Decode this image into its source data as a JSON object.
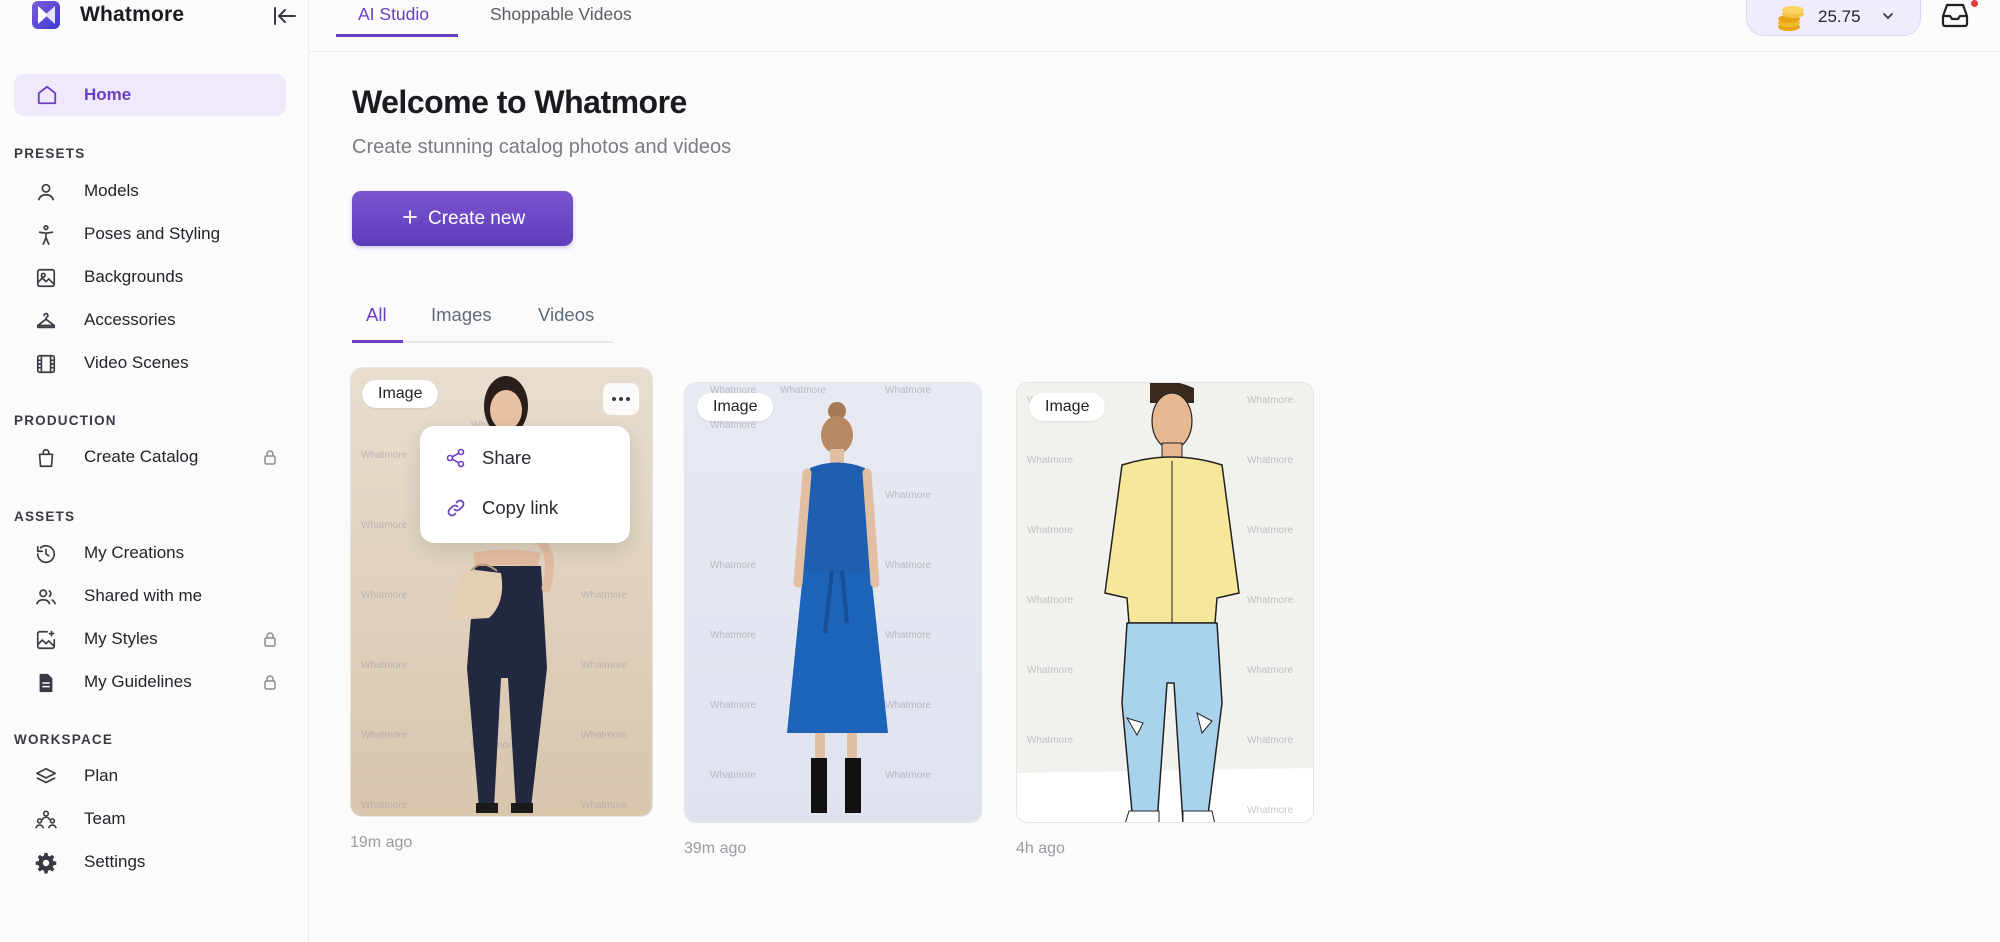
{
  "app": {
    "name": "Whatmore"
  },
  "top_tabs": [
    {
      "label": "AI Studio",
      "active": true
    },
    {
      "label": "Shoppable Videos",
      "active": false
    }
  ],
  "credits": {
    "amount": "25.75"
  },
  "sidebar": {
    "home": {
      "label": "Home",
      "icon": "home-icon"
    },
    "sections": [
      {
        "title": "PRESETS",
        "items": [
          {
            "label": "Models",
            "icon": "user-icon",
            "locked": false
          },
          {
            "label": "Poses and Styling",
            "icon": "pose-icon",
            "locked": false
          },
          {
            "label": "Backgrounds",
            "icon": "image-icon",
            "locked": false
          },
          {
            "label": "Accessories",
            "icon": "hanger-icon",
            "locked": false
          },
          {
            "label": "Video Scenes",
            "icon": "film-icon",
            "locked": false
          }
        ]
      },
      {
        "title": "PRODUCTION",
        "items": [
          {
            "label": "Create Catalog",
            "icon": "bag-icon",
            "locked": true
          }
        ]
      },
      {
        "title": "ASSETS",
        "items": [
          {
            "label": "My Creations",
            "icon": "history-icon",
            "locked": false
          },
          {
            "label": "Shared with me",
            "icon": "users-icon",
            "locked": false
          },
          {
            "label": "My Styles",
            "icon": "image-add-icon",
            "locked": true
          },
          {
            "label": "My Guidelines",
            "icon": "document-icon",
            "locked": true
          }
        ]
      },
      {
        "title": "WORKSPACE",
        "items": [
          {
            "label": "Plan",
            "icon": "layers-icon",
            "locked": false
          },
          {
            "label": "Team",
            "icon": "team-icon",
            "locked": false
          },
          {
            "label": "Settings",
            "icon": "gear-icon",
            "locked": false
          }
        ]
      }
    ]
  },
  "main": {
    "title": "Welcome to Whatmore",
    "subtitle": "Create stunning catalog photos and videos",
    "create_button": "Create new",
    "filter_tabs": [
      {
        "label": "All",
        "active": true
      },
      {
        "label": "Images",
        "active": false
      },
      {
        "label": "Videos",
        "active": false
      }
    ],
    "creations": [
      {
        "badge": "Image",
        "time": "19m ago"
      },
      {
        "badge": "Image",
        "time": "39m ago"
      },
      {
        "badge": "Image",
        "time": "4h ago"
      }
    ],
    "watermark": "Whatmore",
    "context_menu": [
      {
        "label": "Share",
        "icon": "share-icon"
      },
      {
        "label": "Copy link",
        "icon": "link-icon"
      }
    ]
  },
  "colors": {
    "accent": "#6a3fc1",
    "accent_bg": "#efe9fb",
    "badge_dot": "#e3393c"
  }
}
